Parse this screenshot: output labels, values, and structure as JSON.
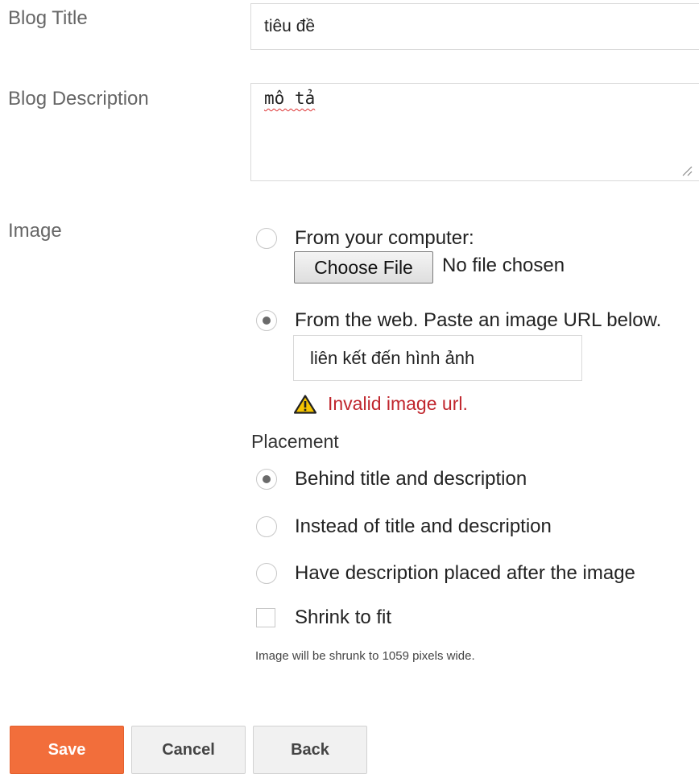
{
  "form": {
    "blog_title_label": "Blog Title",
    "blog_title_value": "tiêu đề",
    "blog_description_label": "Blog Description",
    "blog_description_value": "mô tả",
    "image_label": "Image"
  },
  "image": {
    "source_options": {
      "computer": {
        "label": "From your computer:",
        "checked": false
      },
      "web": {
        "label": "From the web. Paste an image URL below.",
        "checked": true
      }
    },
    "choose_file_label": "Choose File",
    "no_file_text": "No file chosen",
    "url_value": "liên kết đến hình ảnh",
    "error_text": "Invalid image url.",
    "warning_icon": "warning-triangle-icon",
    "error_color": "#c0262d"
  },
  "placement": {
    "heading": "Placement",
    "options": [
      {
        "label": "Behind title and description",
        "checked": true
      },
      {
        "label": "Instead of title and description",
        "checked": false
      },
      {
        "label": "Have description placed after the image",
        "checked": false
      }
    ],
    "shrink_label": "Shrink to fit",
    "shrink_checked": false,
    "note": "Image will be shrunk to 1059 pixels wide."
  },
  "buttons": {
    "save": "Save",
    "cancel": "Cancel",
    "back": "Back",
    "save_color": "#f26e3b"
  }
}
